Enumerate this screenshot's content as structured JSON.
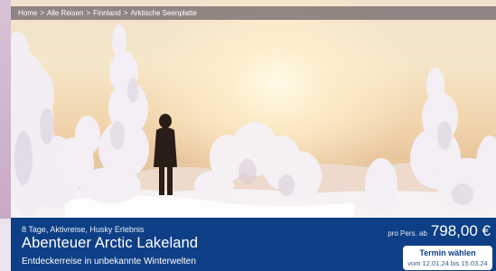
{
  "breadcrumb": {
    "items": [
      "Home",
      "Alle Reisen",
      "Finnland",
      "Arktische Seenplatte"
    ],
    "separator": ">"
  },
  "hero": {
    "image_description_icon": "winter-landscape-image"
  },
  "trip": {
    "tags": "8 Tage, Aktivreise, Husky Erlebnis",
    "title": "Abenteuer Arctic Lakeland",
    "subtitle": "Entdeckerreise in unbekannte Winterwelten",
    "price_prefix": "pro Pers. ab",
    "price": "798,00 €"
  },
  "termin": {
    "label": "Termin wählen",
    "dates": "vom 12.01.24 bis 15.03.24"
  },
  "colors": {
    "panel": "#0e3f86",
    "breadcrumb_bg": "#695f64",
    "button_bg": "#ffffff"
  }
}
